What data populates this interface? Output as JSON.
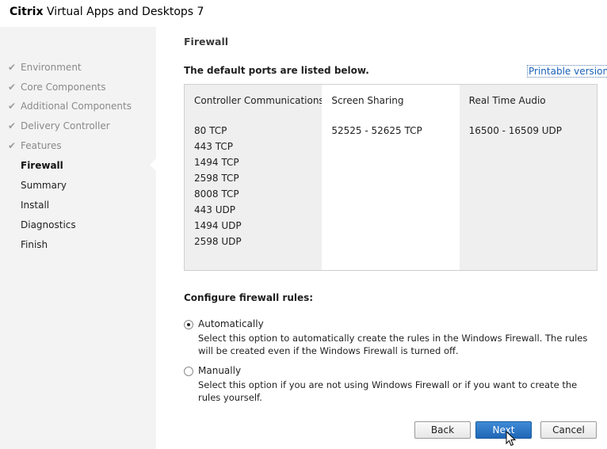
{
  "window": {
    "brand": "Citrix",
    "title": "Virtual Apps and Desktops 7"
  },
  "sidebar": {
    "items": [
      {
        "label": "Environment",
        "state": "done"
      },
      {
        "label": "Core Components",
        "state": "done"
      },
      {
        "label": "Additional Components",
        "state": "done"
      },
      {
        "label": "Delivery Controller",
        "state": "done"
      },
      {
        "label": "Features",
        "state": "done"
      },
      {
        "label": "Firewall",
        "state": "active"
      },
      {
        "label": "Summary",
        "state": "todo"
      },
      {
        "label": "Install",
        "state": "todo"
      },
      {
        "label": "Diagnostics",
        "state": "todo"
      },
      {
        "label": "Finish",
        "state": "todo"
      }
    ]
  },
  "main": {
    "page_title": "Firewall",
    "ports_heading": "The default ports are listed below.",
    "printable_link": "Printable version",
    "ports_table": {
      "columns": [
        {
          "header": "Controller Communications",
          "values": [
            "80 TCP",
            "443 TCP",
            "1494 TCP",
            "2598 TCP",
            "8008 TCP",
            "443 UDP",
            "1494 UDP",
            "2598 UDP"
          ]
        },
        {
          "header": "Screen Sharing",
          "values": [
            "52525 - 52625 TCP"
          ]
        },
        {
          "header": "Real Time Audio",
          "values": [
            "16500 - 16509 UDP"
          ]
        }
      ]
    },
    "rules_heading": "Configure firewall rules:",
    "options": [
      {
        "label": "Automatically",
        "selected": true,
        "description": "Select this option to automatically create the rules in the Windows Firewall.  The rules will be created even if the Windows Firewall is turned off."
      },
      {
        "label": "Manually",
        "selected": false,
        "description": "Select this option if you are not using Windows Firewall or if you want to create the rules yourself."
      }
    ]
  },
  "buttons": {
    "back": "Back",
    "next": "Next",
    "cancel": "Cancel"
  },
  "colors": {
    "sidebar_bg": "#f3f3f3",
    "primary_button": "#2a74c4",
    "link": "#1a62b8",
    "shaded_column": "#efefef"
  }
}
